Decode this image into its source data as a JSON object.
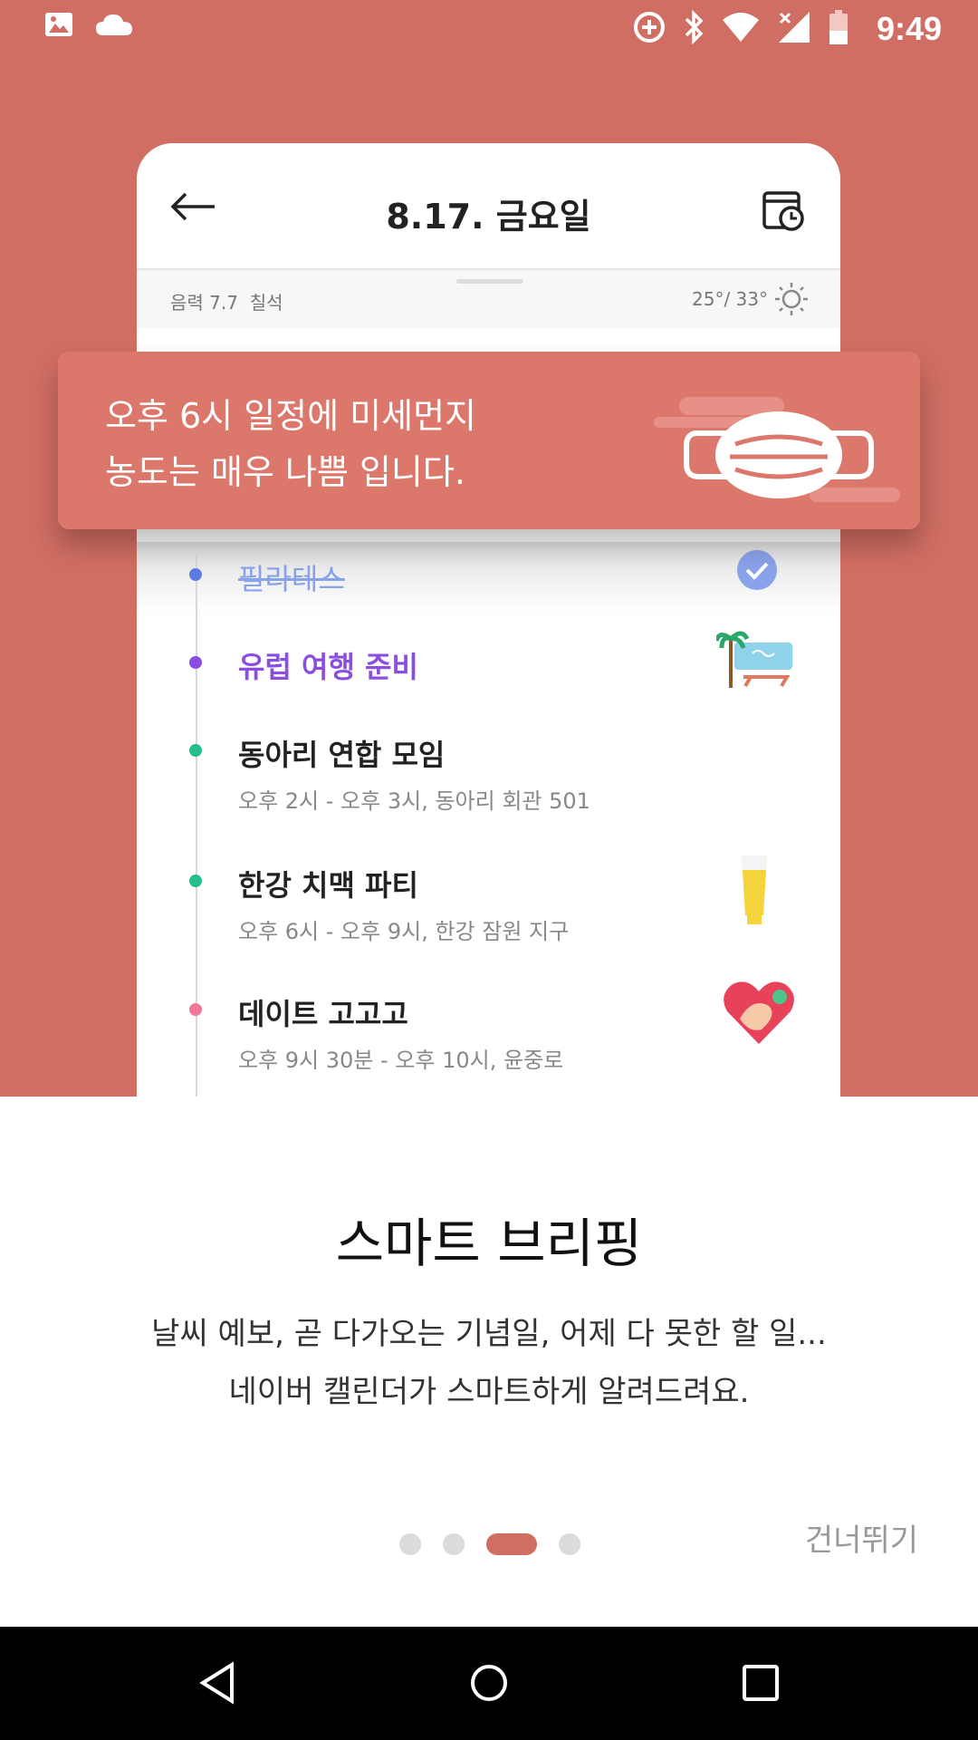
{
  "status_bar": {
    "time": "9:49",
    "left_icons": [
      "image-icon",
      "cloud-icon"
    ],
    "right_icons": [
      "data-saver-icon",
      "bluetooth-icon",
      "wifi-icon",
      "signal-no-service-icon",
      "battery-low-icon"
    ]
  },
  "phone_preview": {
    "header": {
      "date_title": "8.17. 금요일",
      "back_icon": "arrow-left-icon",
      "right_icon": "calendar-clock-icon"
    },
    "subheader": {
      "lunar_date": "음력 7.7",
      "lunar_day_name": "칠석",
      "weather": "25°/ 33°",
      "weather_icon": "sun-icon"
    },
    "events": [
      {
        "title": "필라테스",
        "subtitle": "",
        "dot_color": "#5B7BE0",
        "title_color": "#8AA2EA",
        "completed": true,
        "icon": "check-circle-icon"
      },
      {
        "title": "유럽 여행 준비",
        "subtitle": "",
        "dot_color": "#8A4FE0",
        "title_color": "#8A4FE0",
        "completed": false,
        "icon": "beach-palm-icon"
      },
      {
        "title": "동아리 연합 모임",
        "subtitle": "오후 2시 - 오후 3시, 동아리 회관 501",
        "dot_color": "#22C08A",
        "title_color": "#222222",
        "completed": false,
        "icon": ""
      },
      {
        "title": "한강 치맥 파티",
        "subtitle": "오후 6시 - 오후 9시, 한강 잠원 지구",
        "dot_color": "#22C08A",
        "title_color": "#222222",
        "completed": false,
        "icon": "beer-glass-icon"
      },
      {
        "title": "데이트 고고고",
        "subtitle": "오후 9시 30분 - 오후 10시, 윤중로",
        "dot_color": "#F07898",
        "title_color": "#222222",
        "completed": false,
        "icon": "heart-icon"
      }
    ]
  },
  "banner": {
    "line1": "오후 6시 일정에 미세먼지",
    "line2": "농도는 매우 나쁨 입니다.",
    "icon": "face-mask-icon"
  },
  "onboarding": {
    "title": "스마트 브리핑",
    "desc_line1": "날씨 예보, 곧 다가오는 기념일, 어제 다 못한 할 일...",
    "desc_line2": "네이버 캘린더가 스마트하게 알려드려요.",
    "page_count": 4,
    "active_page": 3,
    "skip_label": "건너뛰기"
  },
  "nav_bar": {
    "icons": [
      "back-triangle-icon",
      "home-circle-icon",
      "recents-square-icon"
    ]
  },
  "colors": {
    "hero_bg": "#D06E63",
    "banner_bg": "#DC776C",
    "active_dot": "#D06E63",
    "inactive_dot": "#DCDCDC"
  }
}
